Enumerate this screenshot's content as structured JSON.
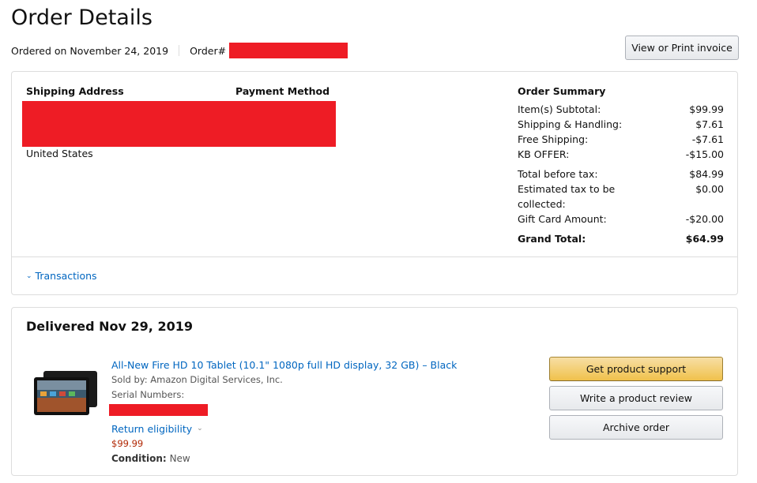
{
  "header": {
    "title": "Order Details",
    "ordered_on": "Ordered on November 24, 2019",
    "order_label": "Order#",
    "invoice_button": "View or Print invoice"
  },
  "colors": {
    "redaction": "#ee1c25",
    "link": "#0066c0",
    "price": "#b12704",
    "support_button": "#f0c14b"
  },
  "details": {
    "shipping_heading": "Shipping Address",
    "payment_heading": "Payment Method",
    "country": "United States",
    "summary_heading": "Order Summary",
    "summary": [
      {
        "label": "Item(s) Subtotal:",
        "value": "$99.99"
      },
      {
        "label": "Shipping & Handling:",
        "value": "$7.61"
      },
      {
        "label": "Free Shipping:",
        "value": "-$7.61"
      },
      {
        "label": "KB OFFER:",
        "value": "-$15.00"
      },
      {
        "label": "Total before tax:",
        "value": "$84.99"
      },
      {
        "label": "Estimated tax to be collected:",
        "value": "$0.00"
      },
      {
        "label": "Gift Card Amount:",
        "value": "-$20.00"
      },
      {
        "label": "Grand Total:",
        "value": "$64.99"
      }
    ],
    "transactions": "Transactions"
  },
  "delivery": {
    "status": "Delivered Nov 29, 2019",
    "item": {
      "title": "All-New Fire HD 10 Tablet (10.1\" 1080p full HD display, 32 GB) – Black",
      "sold_by": "Sold by: Amazon Digital Services, Inc.",
      "serial_label": "Serial Numbers:",
      "return_eligibility": "Return eligibility",
      "price": "$99.99",
      "condition_label": "Condition:",
      "condition_value": "New"
    },
    "buttons": {
      "support": "Get product support",
      "review": "Write a product review",
      "archive": "Archive order"
    }
  }
}
